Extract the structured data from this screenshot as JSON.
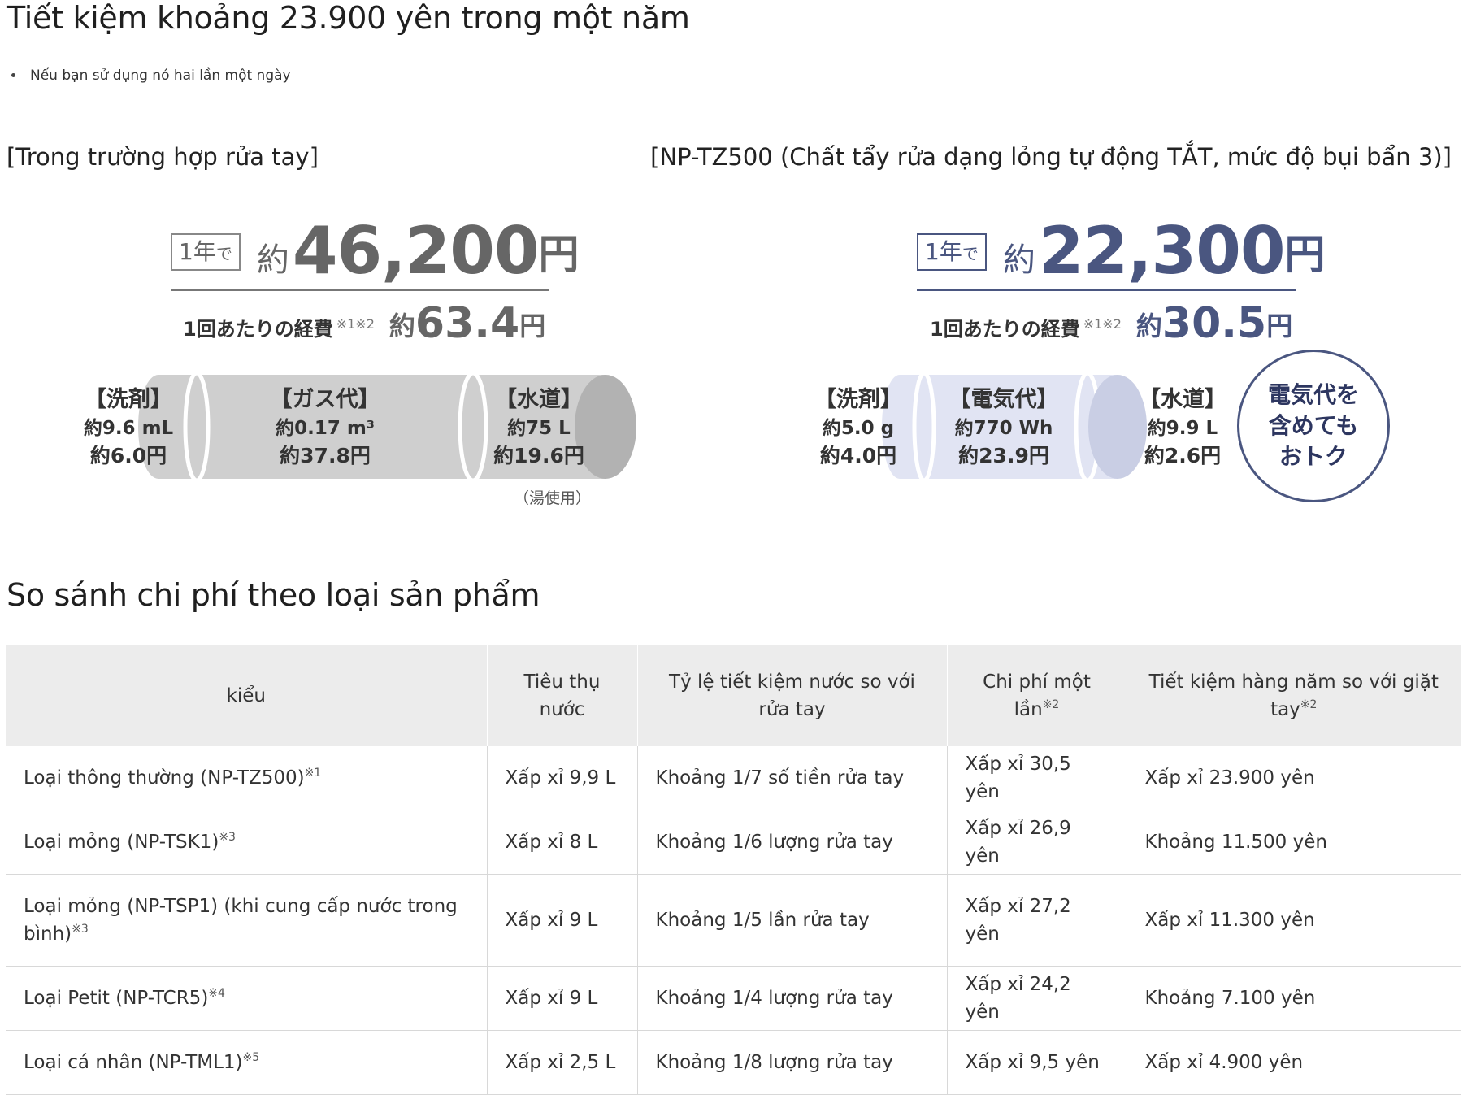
{
  "header": {
    "title": "Tiết kiệm khoảng 23.900 yên trong một năm",
    "bullet": "Nếu bạn sử dụng nó hai lần một ngày"
  },
  "left_panel": {
    "title": "[Trong trường hợp rửa tay]",
    "year_label": "1年",
    "year_label_suffix": "で",
    "yaku": "約",
    "annual_value": "46,200",
    "yen": "円",
    "per_use_label": "1回あたりの経費",
    "per_use_note": "※1※2",
    "per_use_yaku": "約",
    "per_use_value": "63.4",
    "per_use_yen": "円",
    "color": "#666666",
    "segments": [
      {
        "heading": "【洗剤】",
        "line1": "約9.6 mL",
        "line2": "約6.0円"
      },
      {
        "heading": "【ガス代】",
        "line1": "約0.17 m³",
        "line2": "約37.8円"
      },
      {
        "heading": "【水道】",
        "line1": "約75 L",
        "line2": "約19.6円"
      }
    ],
    "water_note": "（湯使用）"
  },
  "right_panel": {
    "title": "[NP-TZ500 (Chất tẩy rửa dạng lỏng tự động TẮT, mức độ bụi bẩn 3)]",
    "year_label": "1年",
    "year_label_suffix": "で",
    "yaku": "約",
    "annual_value": "22,300",
    "yen": "円",
    "per_use_label": "1回あたりの経費",
    "per_use_note": "※1※2",
    "per_use_yaku": "約",
    "per_use_value": "30.5",
    "per_use_yen": "円",
    "color": "#4a5680",
    "segments": [
      {
        "heading": "【洗剤】",
        "line1": "約5.0 g",
        "line2": "約4.0円"
      },
      {
        "heading": "【電気代】",
        "line1": "約770 Wh",
        "line2": "約23.9円"
      },
      {
        "heading": "【水道】",
        "line1": "約9.9 L",
        "line2": "約2.6円"
      }
    ],
    "badge": {
      "line1": "電気代を",
      "line2": "含めても",
      "line3": "おトク"
    }
  },
  "comparison": {
    "title": "So sánh chi phí theo loại sản phẩm",
    "headers": [
      {
        "text": "kiểu",
        "sup": ""
      },
      {
        "text": "Tiêu thụ nước",
        "sup": ""
      },
      {
        "text": "Tỷ lệ tiết kiệm nước so với rửa tay",
        "sup": ""
      },
      {
        "text": "Chi phí một lần",
        "sup": "※2"
      },
      {
        "text": "Tiết kiệm hàng năm so với giặt tay",
        "sup": "※2"
      }
    ],
    "rows": [
      {
        "type": "Loại thông thường (NP-TZ500)",
        "sup": "※1",
        "water": "Xấp xỉ 9,9 L",
        "ratio": "Khoảng 1/7 số tiền rửa tay",
        "cost": "Xấp xỉ 30,5 yên",
        "savings": "Xấp xỉ 23.900 yên"
      },
      {
        "type": "Loại mỏng (NP-TSK1)",
        "sup": "※3",
        "water": "Xấp xỉ 8 L",
        "ratio": "Khoảng 1/6 lượng rửa tay",
        "cost": "Xấp xỉ 26,9 yên",
        "savings": "Khoảng 11.500 yên"
      },
      {
        "type": "Loại mỏng (NP-TSP1) (khi cung cấp nước trong bình)",
        "sup": "※3",
        "water": "Xấp xỉ 9 L",
        "ratio": "Khoảng 1/5 lần rửa tay",
        "cost": "Xấp xỉ 27,2 yên",
        "savings": "Xấp xỉ 11.300 yên"
      },
      {
        "type": "Loại Petit (NP-TCR5)",
        "sup": "※4",
        "water": "Xấp xỉ 9 L",
        "ratio": "Khoảng 1/4 lượng rửa tay",
        "cost": "Xấp xỉ 24,2 yên",
        "savings": "Khoảng 7.100 yên"
      },
      {
        "type": "Loại cá nhân (NP-TML1)",
        "sup": "※5",
        "water": "Xấp xỉ 2,5 L",
        "ratio": "Khoảng 1/8 lượng rửa tay",
        "cost": "Xấp xỉ 9,5 yên",
        "savings": "Xấp xỉ 4.900 yên"
      }
    ]
  }
}
